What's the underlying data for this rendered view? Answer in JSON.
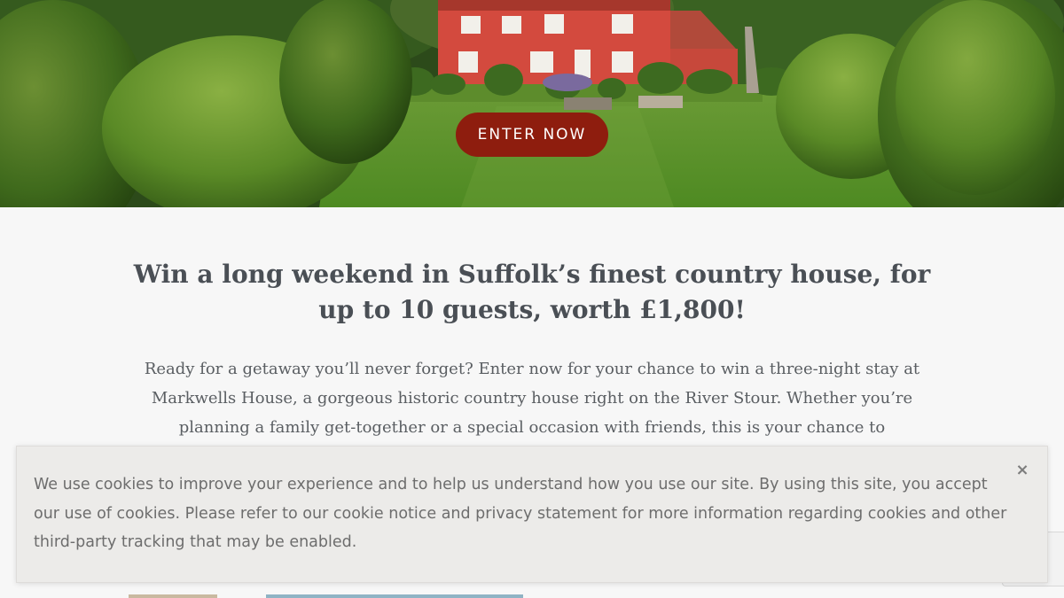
{
  "hero": {
    "image_icon": "country-house-garden-photo",
    "cta_label": "ENTER NOW",
    "cta_color": "#8e1d0e"
  },
  "main": {
    "headline": "Win a long weekend in Suffolk’s finest country house, for up to 10 guests, worth £1,800!",
    "intro": "Ready for a getaway you’ll never forget? Enter now for your chance to win a three-night stay at Markwells House, a gorgeous historic country house right on the River Stour. Whether you’re planning a family get-together or a special occasion with friends, this is your chance to"
  },
  "cookie_banner": {
    "text": "We use cookies to improve your experience and to help us understand how you use our site. By using this site, you accept our use of cookies. Please refer to our cookie notice and privacy statement for more information regarding cookies and other third-party tracking that may be enabled.",
    "close_label": "×",
    "close_icon": "close-icon",
    "background": "#ecebe9"
  },
  "colors": {
    "page_background": "#f7f7f7",
    "heading": "#4a4f55",
    "body_text": "#5a5e62"
  }
}
